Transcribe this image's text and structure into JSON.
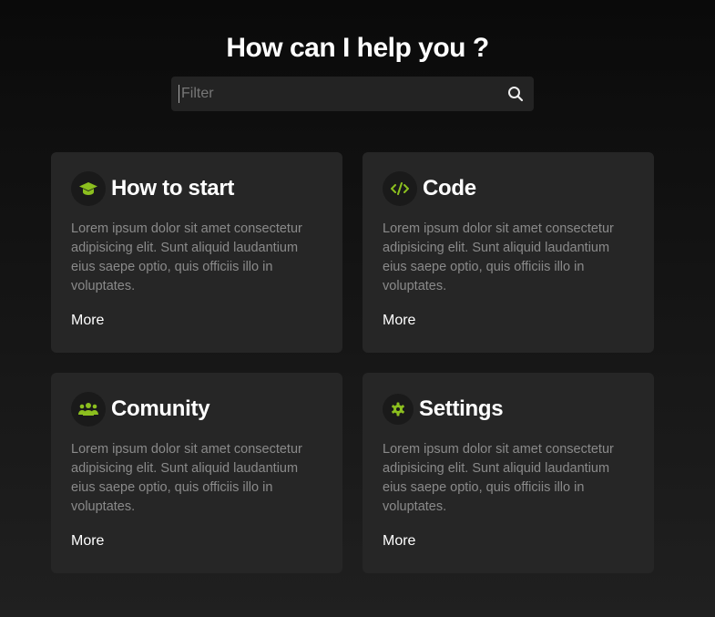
{
  "header": {
    "title": "How can I help you ?"
  },
  "search": {
    "placeholder": "Filter",
    "value": ""
  },
  "colors": {
    "accent": "#8cbf1f",
    "card": "#262626"
  },
  "cards": [
    {
      "title": "How to start",
      "icon": "graduation-cap-icon",
      "description": "Lorem ipsum dolor sit amet consectetur adipisicing elit. Sunt aliquid laudantium eius saepe optio, quis officiis illo in voluptates.",
      "link": "More"
    },
    {
      "title": "Code",
      "icon": "code-icon",
      "description": "Lorem ipsum dolor sit amet consectetur adipisicing elit. Sunt aliquid laudantium eius saepe optio, quis officiis illo in voluptates.",
      "link": "More"
    },
    {
      "title": "Comunity",
      "icon": "users-icon",
      "description": "Lorem ipsum dolor sit amet consectetur adipisicing elit. Sunt aliquid laudantium eius saepe optio, quis officiis illo in voluptates.",
      "link": "More"
    },
    {
      "title": "Settings",
      "icon": "gear-icon",
      "description": "Lorem ipsum dolor sit amet consectetur adipisicing elit. Sunt aliquid laudantium eius saepe optio, quis officiis illo in voluptates.",
      "link": "More"
    }
  ]
}
